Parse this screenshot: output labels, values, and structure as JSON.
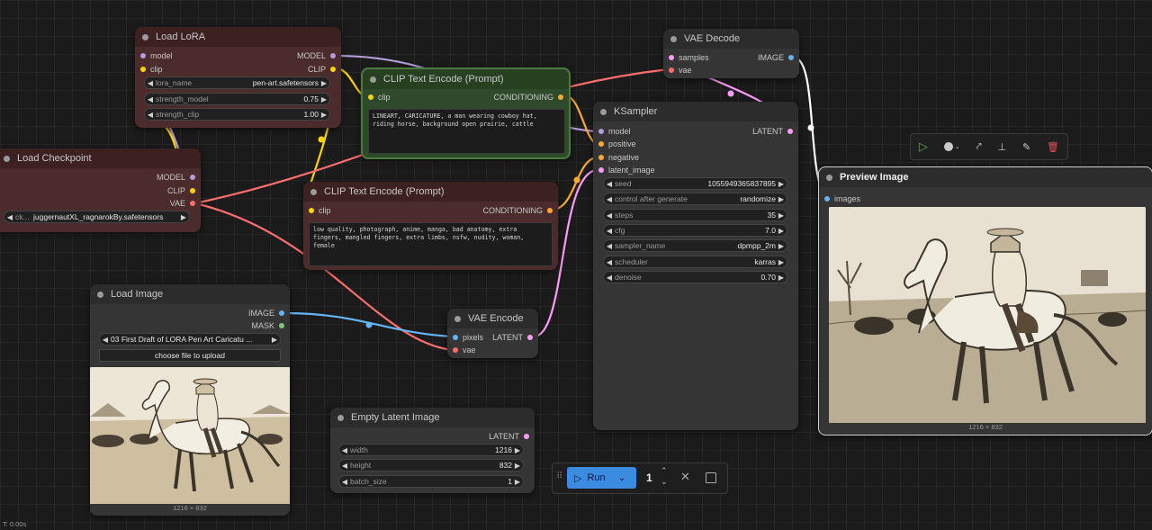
{
  "nodes": {
    "load_lora": {
      "title": "Load LoRA",
      "inputs": [
        "model",
        "clip"
      ],
      "outputs": [
        "MODEL",
        "CLIP"
      ],
      "widgets": [
        {
          "label": "lora_name",
          "value": "pen-art.safetensors"
        },
        {
          "label": "strength_model",
          "value": "0.75"
        },
        {
          "label": "strength_clip",
          "value": "1.00"
        }
      ]
    },
    "load_checkpoint": {
      "title": "Load Checkpoint",
      "outputs": [
        "MODEL",
        "CLIP",
        "VAE"
      ],
      "widgets": [
        {
          "label": "ck...",
          "value": "juggernautXL_ragnarokBy.safetensors"
        }
      ]
    },
    "clip_pos": {
      "title": "CLIP Text Encode (Prompt)",
      "inputs": [
        "clip"
      ],
      "outputs": [
        "CONDITIONING"
      ],
      "text": "LINEART, CARICATURE, a man wearing cowboy hat, riding horse, background open prairie, cattle"
    },
    "clip_neg": {
      "title": "CLIP Text Encode (Prompt)",
      "inputs": [
        "clip"
      ],
      "outputs": [
        "CONDITIONING"
      ],
      "text": "low quality, photograph, anime, manga, bad anatomy, extra fingers, mangled fingers, extra limbs, nsfw, nudity, woman, female"
    },
    "vae_decode": {
      "title": "VAE Decode",
      "inputs": [
        "samples",
        "vae"
      ],
      "outputs": [
        "IMAGE"
      ]
    },
    "ksampler": {
      "title": "KSampler",
      "inputs": [
        "model",
        "positive",
        "negative",
        "latent_image"
      ],
      "outputs": [
        "LATENT"
      ],
      "widgets": [
        {
          "label": "seed",
          "value": "1055949365837895"
        },
        {
          "label": "control after generate",
          "value": "randomize"
        },
        {
          "label": "steps",
          "value": "35"
        },
        {
          "label": "cfg",
          "value": "7.0"
        },
        {
          "label": "sampler_name",
          "value": "dpmpp_2m"
        },
        {
          "label": "scheduler",
          "value": "karras"
        },
        {
          "label": "denoise",
          "value": "0.70"
        }
      ]
    },
    "preview_image": {
      "title": "Preview Image",
      "inputs": [
        "images"
      ],
      "caption": "1216 × 832"
    },
    "load_image": {
      "title": "Load Image",
      "outputs": [
        "IMAGE",
        "MASK"
      ],
      "file": "03 First Draft of LORA Pen Art Caricatu ...",
      "upload_label": "choose file to upload",
      "caption": "1216 × 832"
    },
    "vae_encode": {
      "title": "VAE Encode",
      "inputs": [
        "pixels",
        "vae"
      ],
      "outputs": [
        "LATENT"
      ]
    },
    "empty_latent": {
      "title": "Empty Latent Image",
      "outputs": [
        "LATENT"
      ],
      "widgets": [
        {
          "label": "width",
          "value": "1216"
        },
        {
          "label": "height",
          "value": "832"
        },
        {
          "label": "batch_size",
          "value": "1"
        }
      ]
    }
  },
  "run_bar": {
    "run_label": "Run",
    "count": "1"
  },
  "toolbox": {
    "icons": [
      "play-icon",
      "color-circle-icon",
      "bypass-icon",
      "pin-icon",
      "edit-icon",
      "trash-icon"
    ]
  },
  "status": {
    "time": "T: 0.00s"
  },
  "colors": {
    "model": "#b39ddb",
    "clip": "#ffd500",
    "vae": "#ff6e6e",
    "conditioning": "#ffa931",
    "latent": "#ff9cf9",
    "image": "#64b5f6",
    "mask": "#81c784"
  }
}
